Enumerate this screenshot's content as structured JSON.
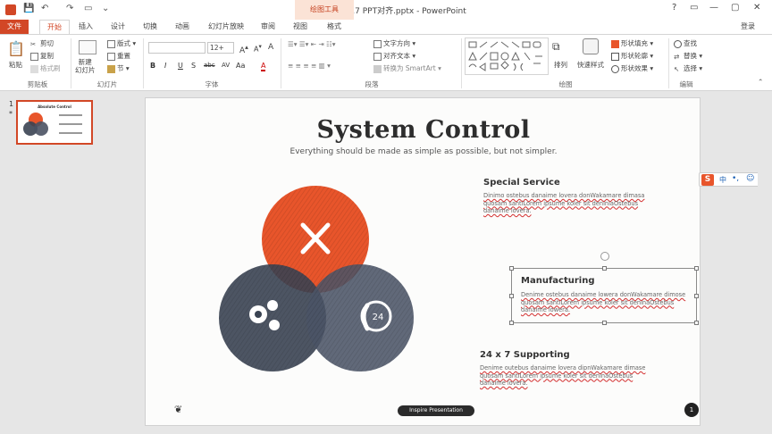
{
  "window": {
    "title": "BG 426+1 17 PPT对齐.pptx - PowerPoint",
    "contextual_tab_group": "绘图工具",
    "login": "登录",
    "controls": [
      "?",
      "▭",
      "—",
      "▢",
      "✕"
    ]
  },
  "tabs": [
    "文件",
    "开始",
    "插入",
    "设计",
    "切换",
    "动画",
    "幻灯片放映",
    "审阅",
    "视图",
    "格式"
  ],
  "active_tab": "开始",
  "ribbon": {
    "clipboard": {
      "label": "剪贴板",
      "paste": "粘贴",
      "cut": "剪切",
      "copy": "复制",
      "format_painter": "格式刷"
    },
    "slides": {
      "label": "幻灯片",
      "new_slide": "新建\n幻灯片",
      "layout": "版式",
      "reset": "重置",
      "section": "节"
    },
    "font": {
      "label": "字体",
      "font_size": "12+",
      "buttons": [
        "B",
        "I",
        "U",
        "S",
        "abc",
        "AV",
        "Aa",
        "A"
      ]
    },
    "paragraph": {
      "label": "段落",
      "text_direction": "文字方向",
      "align_text": "对齐文本",
      "smartart": "转换为 SmartArt"
    },
    "drawing": {
      "label": "绘图",
      "arrange": "排列",
      "quick_styles": "快速样式",
      "shape_fill": "形状填充",
      "shape_outline": "形状轮廓",
      "shape_effects": "形状效果"
    },
    "editing": {
      "label": "编辑",
      "find": "查找",
      "replace": "替换",
      "select": "选择"
    }
  },
  "thumbnail": {
    "number": "1",
    "star": "*",
    "title": "Absolute Control"
  },
  "slide": {
    "title": "System Control",
    "subtitle": "Everything should be made as simple as possible, but not simpler.",
    "sections": [
      {
        "heading": "Special Service",
        "body": "Dinimo ostebus danaime lovera donWakamare dimasa quosam santiLorem ipsume koler sit deniniaOstebus danaime lovera."
      },
      {
        "heading": "Manufacturing",
        "body": "Denime ostebus danaime lowera donWakamare dimose quosam santiLorem ipsume koler sit deninaOstebus danaime lowera."
      },
      {
        "heading": "24 x 7 Supporting",
        "body": "Denime outebus danaime lovera dipnWakamare dimase quosam santiLorem ipsume koler sit deninaOstebus danaime lovera."
      }
    ],
    "circle_icons": [
      "tools-icon",
      "gears-icon",
      "phone-24-icon"
    ],
    "circle_24_label": "24",
    "footer_pill": "Inspire Presentation",
    "page_number": "1",
    "colors": {
      "orange": "#e8552b",
      "slate": "#3a4352",
      "accent": "#d24726"
    }
  },
  "ime": {
    "logo": "S",
    "lang": "中"
  }
}
